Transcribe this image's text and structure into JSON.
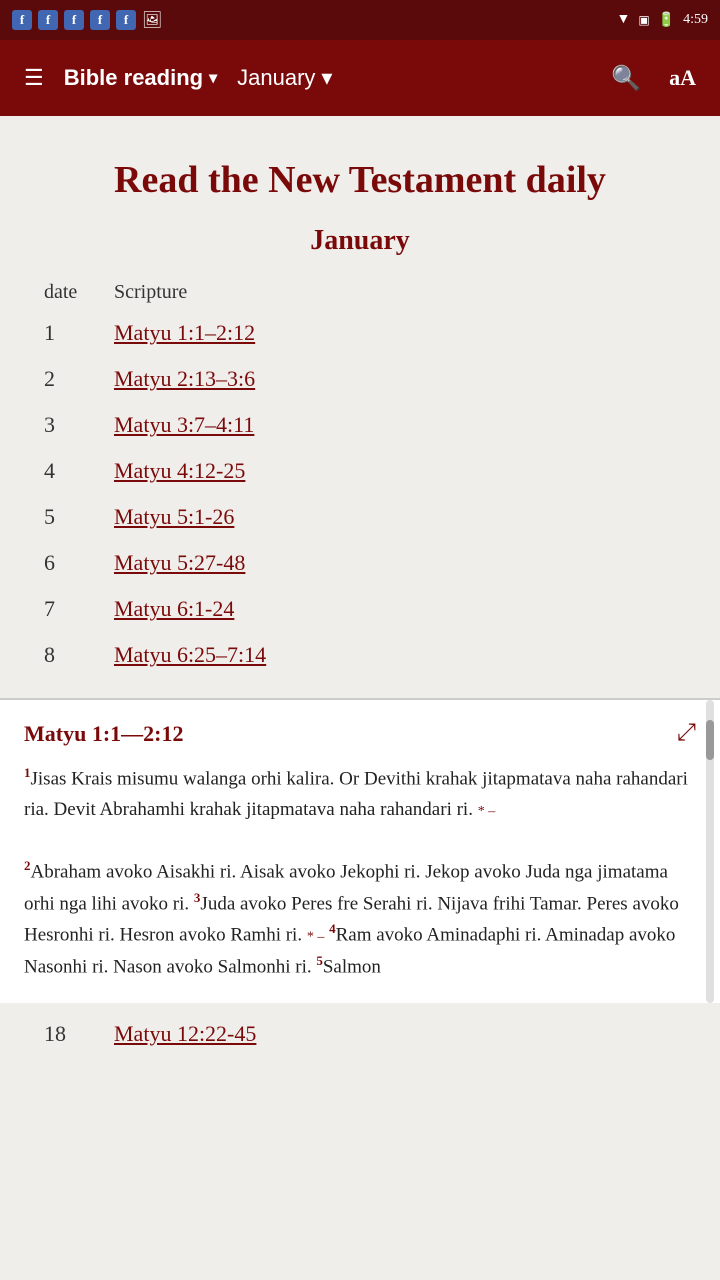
{
  "statusBar": {
    "time": "4:59",
    "icons": [
      "fb",
      "fb",
      "fb",
      "fb",
      "fb",
      "gallery"
    ]
  },
  "toolbar": {
    "menuIcon": "☰",
    "title": "Bible reading",
    "titleDropdown": "▾",
    "month": "January",
    "monthDropdown": "▾",
    "searchIcon": "🔍",
    "fontIcon": "aA"
  },
  "page": {
    "heading": "Read the New Testament daily",
    "monthHeading": "January",
    "columns": {
      "date": "date",
      "scripture": "Scripture"
    },
    "rows": [
      {
        "day": "1",
        "scripture": "Matyu 1:1–2:12"
      },
      {
        "day": "2",
        "scripture": "Matyu 2:13–3:6"
      },
      {
        "day": "3",
        "scripture": "Matyu 3:7–4:11"
      },
      {
        "day": "4",
        "scripture": "Matyu 4:12-25"
      },
      {
        "day": "5",
        "scripture": "Matyu 5:1-26"
      },
      {
        "day": "6",
        "scripture": "Matyu 5:27-48"
      },
      {
        "day": "7",
        "scripture": "Matyu 6:1-24"
      },
      {
        "day": "8",
        "scripture": "Matyu 6:25–7:14"
      }
    ],
    "bottomRow": {
      "day": "18",
      "scripture": "Matyu 12:22-45"
    }
  },
  "preview": {
    "title": "Matyu 1:1—2:12",
    "externalIcon": "⤢",
    "verse1": "1",
    "text1": "Jisas Krais misumu walanga orhi kalira. Or Devithi krahak jitapmatava naha rahandari ria. Devit Abrahamhi krahak jitapmatava naha rahandari ri. ",
    "refMark1": "*  –",
    "verse2": "2",
    "text2": "Abraham avoko Aisakhi ri. Aisak avoko Jekophi ri. Jekop avoko Juda nga jimatama orhi nga lihi avoko ri. ",
    "verse3": "3",
    "text3": "Juda avoko Peres fre Serahi ri. Nijava frihi Tamar. Peres avoko Hesronhi ri. Hesron avoko Ramhi ri. ",
    "refMark3": "* –",
    "verse4": "4",
    "text4": "Ram avoko Aminadaphi ri. Aminadap avoko Nasonhi ri. Nason avoko Salmonhi ri. ",
    "verse5": "5",
    "text5": "Salmon"
  }
}
